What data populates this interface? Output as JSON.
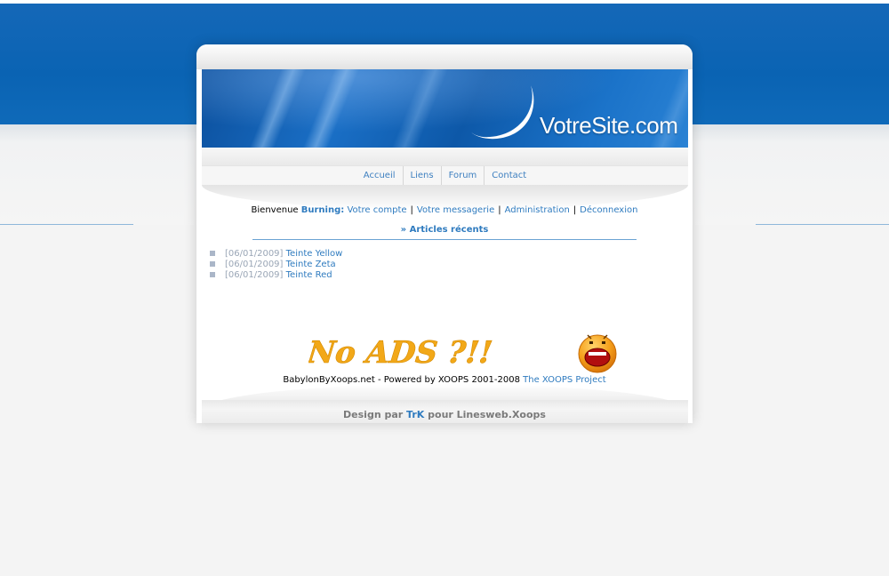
{
  "site": {
    "logo_text": "VotreSite.com"
  },
  "menu": [
    {
      "label": "Accueil"
    },
    {
      "label": "Liens"
    },
    {
      "label": "Forum"
    },
    {
      "label": "Contact"
    }
  ],
  "user_bar": {
    "welcome": "Bienvenue",
    "username": "Burning:",
    "links": [
      {
        "label": "Votre compte"
      },
      {
        "label": "Votre messagerie"
      },
      {
        "label": "Administration"
      },
      {
        "label": "Déconnexion"
      }
    ],
    "separator": "|"
  },
  "recent": {
    "title": "» Articles récents",
    "items": [
      {
        "date": "[06/01/2009]",
        "title": "Teinte Yellow"
      },
      {
        "date": "[06/01/2009]",
        "title": "Teinte Zeta"
      },
      {
        "date": "[06/01/2009]",
        "title": "Teinte Red"
      }
    ]
  },
  "ad": {
    "text": "No ADS ?!!",
    "icon": "shouting-smiley-icon"
  },
  "footer": {
    "powered_text": "BabylonByXoops.net - Powered by XOOPS 2001-2008",
    "powered_link": "The XOOPS Project",
    "design_prefix": "Design par",
    "design_author": "TrK",
    "design_suffix": "pour Linesweb.Xoops"
  },
  "colors": {
    "brand_blue": "#0a63b3",
    "link": "#2f7bbf"
  }
}
